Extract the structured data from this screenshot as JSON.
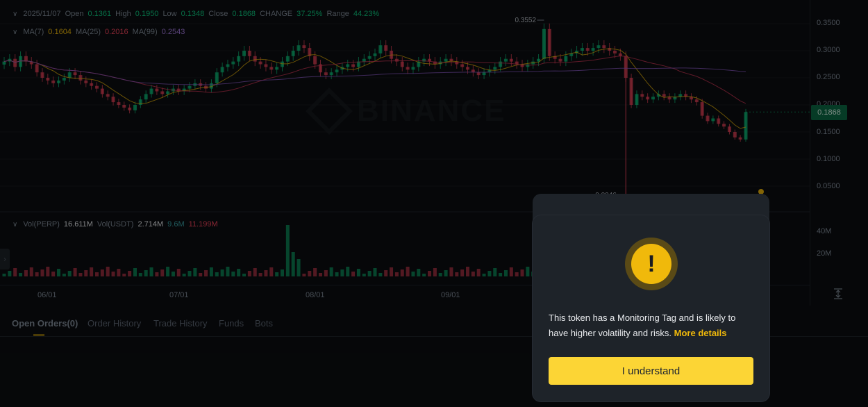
{
  "ohlc": {
    "date": "2025/11/07",
    "open_label": "Open",
    "open": "0.1361",
    "high_label": "High",
    "high": "0.1950",
    "low_label": "Low",
    "low": "0.1348",
    "close_label": "Close",
    "close": "0.1868",
    "change_label": "CHANGE",
    "change": "37.25%",
    "range_label": "Range",
    "range": "44.23%"
  },
  "ma": {
    "ma7_label": "MA(7)",
    "ma7": "0.1604",
    "ma25_label": "MA(25)",
    "ma25": "0.2016",
    "ma99_label": "MA(99)",
    "ma99": "0.2543"
  },
  "volume": {
    "perp_label": "Vol(PERP)",
    "perp": "16.611M",
    "usdt_label": "Vol(USDT)",
    "usdt": "2.714M",
    "ma1": "9.6M",
    "ma2": "11.199M"
  },
  "price_axis": [
    "0.3500",
    "0.3000",
    "0.2500",
    "0.2000",
    "0.1500",
    "0.1000",
    "0.0500"
  ],
  "volume_axis": [
    "40M",
    "20M"
  ],
  "current_price": "0.1868",
  "high_marker": "0.3552",
  "low_marker": "0.0046",
  "date_axis": [
    "06/01",
    "07/01",
    "08/01",
    "09/01"
  ],
  "watermark": "BINANCE",
  "tabs": [
    "Open Orders(0)",
    "Order History",
    "Trade History",
    "Funds",
    "Bots"
  ],
  "modal": {
    "message": "This token has a Monitoring Tag and is likely to have higher volatility and risks.",
    "link": "More details",
    "button": "I understand",
    "icon_glyph": "!"
  },
  "colors": {
    "up": "#0ecb81",
    "down": "#f6465d",
    "ma7": "#f0b90b",
    "ma25": "#d83a5a",
    "ma99": "#8e5cc9",
    "accent": "#fcd535"
  },
  "chart_data": {
    "type": "candlestick",
    "x": [
      "06/01",
      "07/01",
      "08/01",
      "09/01"
    ],
    "ylim": [
      0,
      0.38
    ],
    "close_series": [
      0.28,
      0.285,
      0.27,
      0.29,
      0.28,
      0.275,
      0.26,
      0.25,
      0.245,
      0.24,
      0.245,
      0.25,
      0.26,
      0.255,
      0.245,
      0.24,
      0.235,
      0.23,
      0.22,
      0.215,
      0.205,
      0.2,
      0.195,
      0.19,
      0.2,
      0.21,
      0.22,
      0.23,
      0.225,
      0.22,
      0.225,
      0.23,
      0.225,
      0.23,
      0.235,
      0.24,
      0.235,
      0.23,
      0.24,
      0.26,
      0.27,
      0.275,
      0.28,
      0.29,
      0.3,
      0.29,
      0.28,
      0.275,
      0.27,
      0.265,
      0.27,
      0.28,
      0.29,
      0.3,
      0.31,
      0.305,
      0.29,
      0.275,
      0.26,
      0.255,
      0.26,
      0.265,
      0.27,
      0.275,
      0.27,
      0.28,
      0.285,
      0.29,
      0.295,
      0.31,
      0.3,
      0.285,
      0.28,
      0.27,
      0.265,
      0.27,
      0.28,
      0.285,
      0.28,
      0.275,
      0.28,
      0.285,
      0.28,
      0.275,
      0.27,
      0.265,
      0.26,
      0.255,
      0.26,
      0.265,
      0.27,
      0.28,
      0.285,
      0.28,
      0.275,
      0.27,
      0.275,
      0.28,
      0.285,
      0.34,
      0.29,
      0.285,
      0.28,
      0.29,
      0.295,
      0.3,
      0.305,
      0.3,
      0.305,
      0.31,
      0.305,
      0.3,
      0.295,
      0.29,
      0.25,
      0.2,
      0.22,
      0.215,
      0.21,
      0.215,
      0.22,
      0.215,
      0.21,
      0.215,
      0.22,
      0.215,
      0.21,
      0.205,
      0.18,
      0.17,
      0.175,
      0.165,
      0.16,
      0.15,
      0.14,
      0.1361,
      0.1868
    ]
  }
}
